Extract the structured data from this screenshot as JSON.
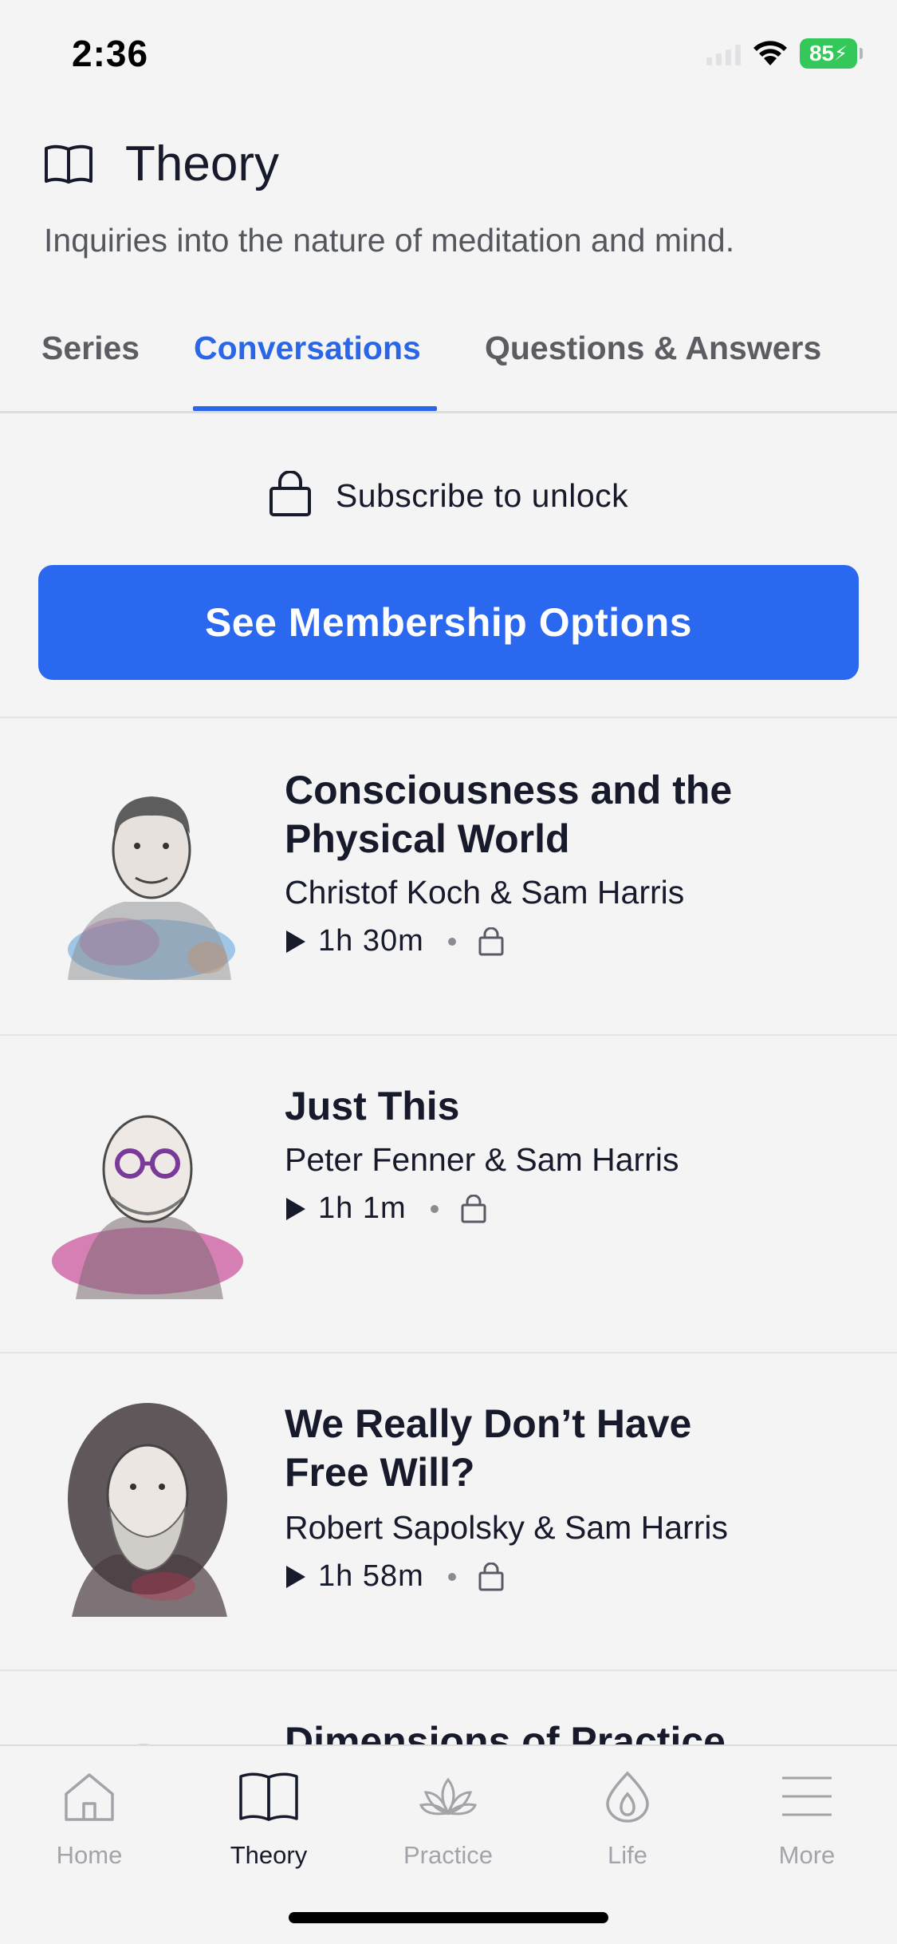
{
  "status_bar": {
    "time": "2:36",
    "battery": "85"
  },
  "header": {
    "title": "Theory",
    "subtitle": "Inquiries into the nature of meditation and mind."
  },
  "tabs": [
    {
      "label": "Series",
      "active": false
    },
    {
      "label": "Conversations",
      "active": true
    },
    {
      "label": "Questions & Answers",
      "active": false
    }
  ],
  "subscribe": {
    "text": "Subscribe to unlock",
    "cta_label": "See Membership Options"
  },
  "conversations": [
    {
      "title_line1": "Consciousness and the",
      "title_line2": "Physical World",
      "speakers": "Christof Koch & Sam Harris",
      "duration": "1h 30m",
      "locked": true
    },
    {
      "title_line1": "Just This",
      "title_line2": "",
      "speakers": "Peter Fenner & Sam Harris",
      "duration": "1h 1m",
      "locked": true
    },
    {
      "title_line1": "We Really Don’t Have",
      "title_line2": "Free Will?",
      "speakers": "Robert Sapolsky & Sam Harris",
      "duration": "1h 58m",
      "locked": true
    },
    {
      "title_line1": "Dimensions of Practice",
      "title_line2": "",
      "speakers": "",
      "duration": "",
      "locked": true
    }
  ],
  "tab_bar": [
    {
      "label": "Home",
      "icon": "home-icon",
      "active": false
    },
    {
      "label": "Theory",
      "icon": "book-icon",
      "active": true
    },
    {
      "label": "Practice",
      "icon": "lotus-icon",
      "active": false
    },
    {
      "label": "Life",
      "icon": "drop-icon",
      "active": false
    },
    {
      "label": "More",
      "icon": "menu-icon",
      "active": false
    }
  ],
  "colors": {
    "accent": "#2b68f0",
    "text": "#161a2b",
    "muted": "#a3a4a9",
    "battery": "#34c759"
  }
}
